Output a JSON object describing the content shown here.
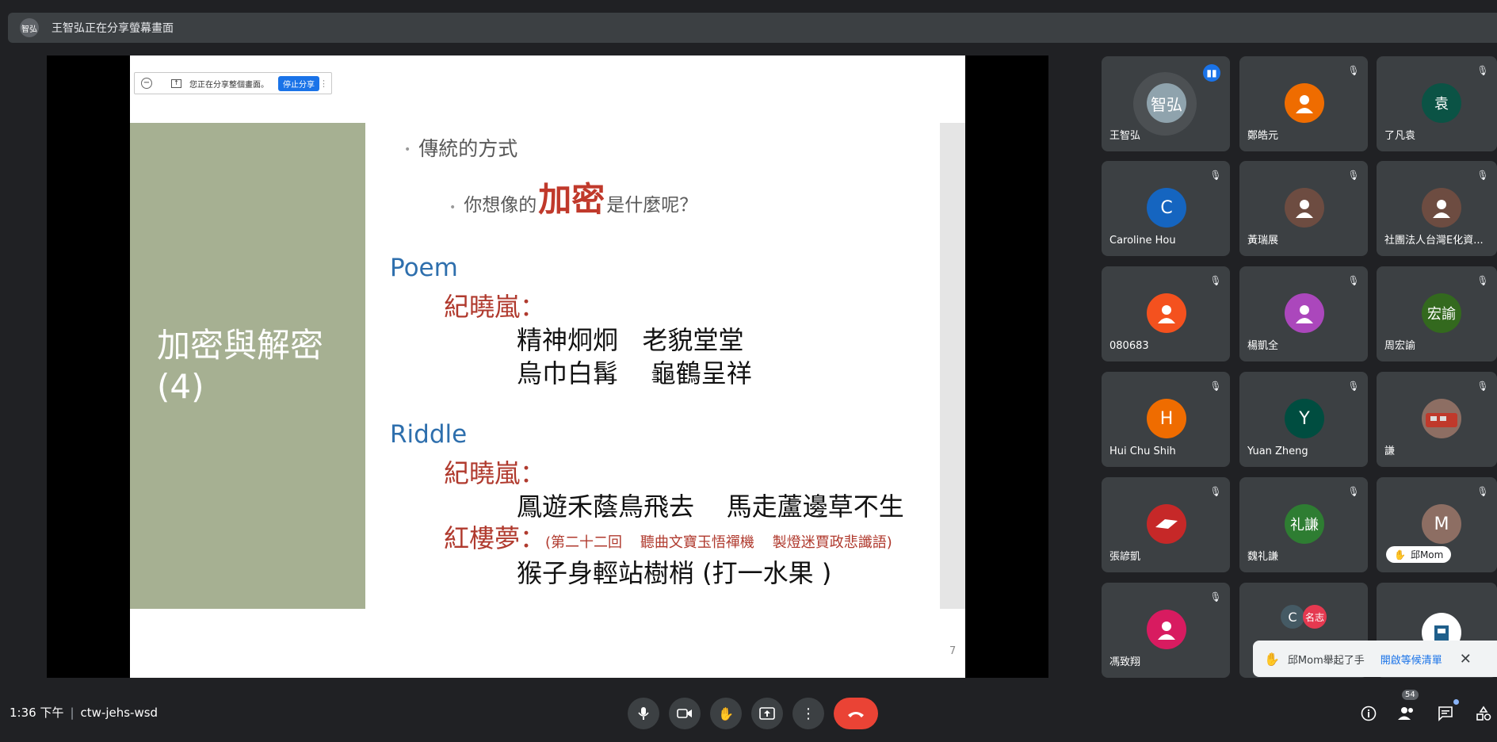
{
  "banner": {
    "avatar": "智弘",
    "text": "王智弘正在分享螢幕畫面"
  },
  "share_bar": {
    "minimize": "−",
    "text": "您正在分享整個畫面。",
    "stop": "停止分享",
    "more": "⋮"
  },
  "slide": {
    "title_line1": "加密與解密",
    "title_line2": "(4)",
    "bullet1": "傳統的方式",
    "bullet2_pre": "你想像的",
    "bullet2_big": "加密",
    "bullet2_post": "是什麼呢？",
    "poem_heading": "Poem",
    "poem_author": "紀曉嵐：",
    "poem_line1": "精神炯炯   老貌堂堂",
    "poem_line2": "烏巾白髯    龜鶴呈祥",
    "riddle_heading": "Riddle",
    "riddle_author": "紀曉嵐：",
    "riddle_line1": "鳳遊禾蔭鳥飛去    馬走蘆邊草不生",
    "riddle_author2": "紅樓夢：",
    "riddle_note": "(第二十二回    聽曲文寶玉悟禪機    製燈迷賈政悲讖語)",
    "riddle_line2": "猴子身輕站樹梢 (打一水果 )",
    "page_number": "7"
  },
  "participants": [
    {
      "name": "王智弘",
      "avatar": "智弘",
      "color": "#8fa3ad"
    },
    {
      "name": "鄭皓元",
      "avatar": "",
      "color": "#ef6c00"
    },
    {
      "name": "了凡袁",
      "avatar": "袁",
      "color": "#0b5345"
    },
    {
      "name": "Caroline Hou",
      "avatar": "C",
      "color": "#1565c0"
    },
    {
      "name": "黃瑞展",
      "avatar": "",
      "color": "#6d4c41"
    },
    {
      "name": "社團法人台灣E化資...",
      "avatar": "",
      "color": "#6d4c41"
    },
    {
      "name": "080683",
      "avatar": "",
      "color": "#f4511e"
    },
    {
      "name": "楊凱全",
      "avatar": "",
      "color": "#ab47bc"
    },
    {
      "name": "周宏諭",
      "avatar": "宏諭",
      "color": "#33691e"
    },
    {
      "name": "Hui Chu Shih",
      "avatar": "H",
      "color": "#ef6c00"
    },
    {
      "name": "Yuan Zheng",
      "avatar": "Y",
      "color": "#004d40"
    },
    {
      "name": "謙",
      "avatar": "",
      "color": "#8d6e63"
    },
    {
      "name": "張諺凱",
      "avatar": "",
      "color": "#c62828"
    },
    {
      "name": "魏礼謙",
      "avatar": "礼謙",
      "color": "#2e7d32"
    },
    {
      "name": "邱Mom",
      "avatar": "M",
      "color": "#8d6e63"
    },
    {
      "name": "馮致翔",
      "avatar": "",
      "color": "#d81b60"
    },
    {
      "name": "",
      "avatar": "名志",
      "color": "#e53950"
    },
    {
      "name": "",
      "avatar": "",
      "color": "#ffffff"
    }
  ],
  "toast": {
    "message": "邱Mom舉起了手",
    "link": "開啟等候清單",
    "close": "✕"
  },
  "bottom": {
    "time": "1:36 下午",
    "separator": "|",
    "meeting_code": "ctw-jehs-wsd",
    "people_count": "54"
  }
}
